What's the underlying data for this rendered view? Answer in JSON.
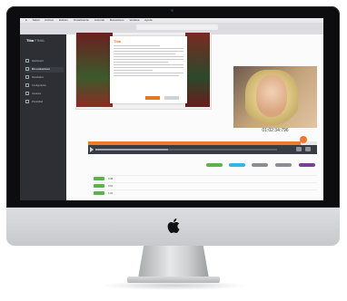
{
  "menubar": {
    "items": [
      "Safari",
      "Archivo",
      "Edición",
      "Visualización",
      "Historial",
      "Marcadores",
      "Ventana",
      "Ayuda"
    ]
  },
  "browser": {
    "tab_title": ""
  },
  "sidebar": {
    "brand": "Tiba",
    "brand_sub": "FINAL",
    "items": [
      {
        "label": "Dashboard"
      },
      {
        "label": "Mis evaluaciones"
      },
      {
        "label": "Resultados"
      },
      {
        "label": "Configuración"
      },
      {
        "label": "Usuarios"
      },
      {
        "label": "Privacidad"
      }
    ]
  },
  "document": {
    "logo": "Tiba"
  },
  "video": {
    "timecode": "01:02:34:796"
  },
  "player": {
    "progress": 0.93,
    "volume_level": 0.4
  },
  "tags": [
    {
      "label": "",
      "color": "#58b548"
    },
    {
      "label": "",
      "color": "#2fb7e6"
    },
    {
      "label": "",
      "color": "#8b8d94"
    },
    {
      "label": "",
      "color": "#8b8d94"
    },
    {
      "label": "",
      "color": "#7a3f98"
    }
  ],
  "rows": [
    {
      "time": "0:48",
      "text": ""
    },
    {
      "time": "0:51",
      "text": ""
    },
    {
      "time": "1:02",
      "text": ""
    }
  ],
  "colors": {
    "accent": "#f07a2a",
    "sidebar": "#2e2f35",
    "positive": "#58b548"
  }
}
